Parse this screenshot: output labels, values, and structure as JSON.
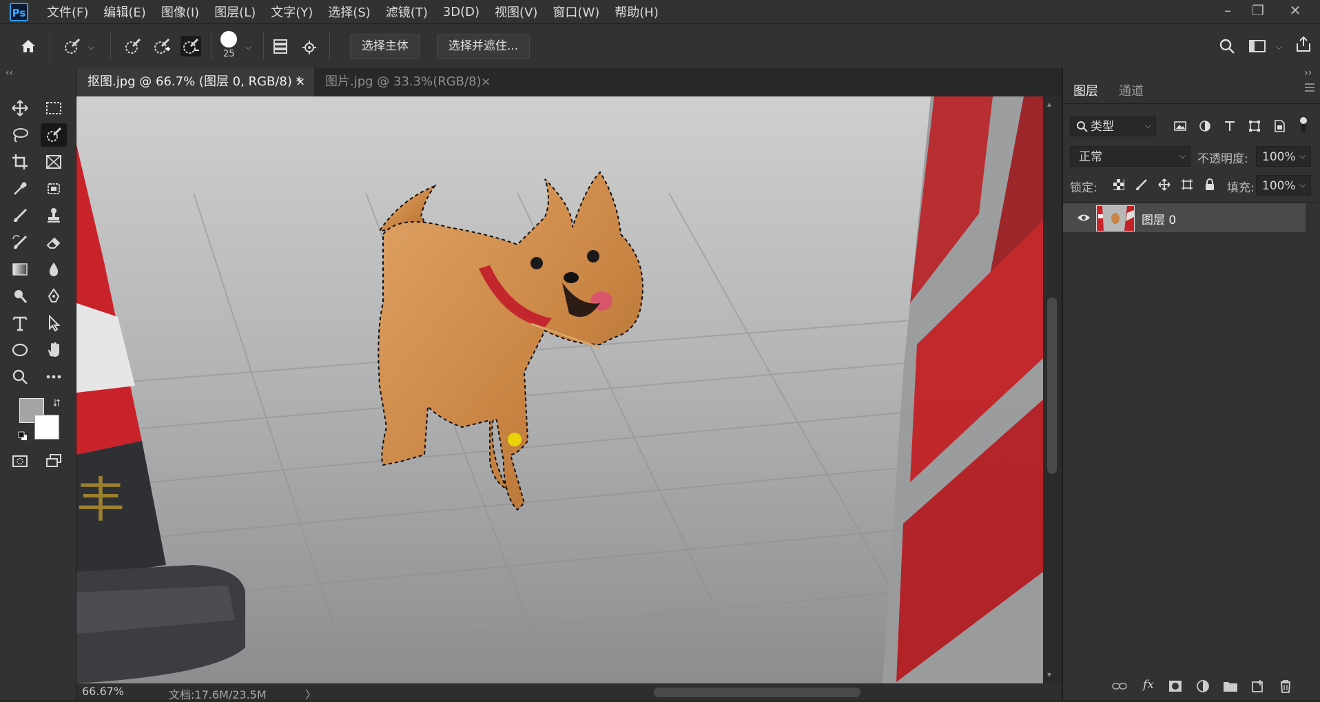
{
  "app": {
    "logo": "Ps"
  },
  "menu": [
    "文件(F)",
    "编辑(E)",
    "图像(I)",
    "图层(L)",
    "文字(Y)",
    "选择(S)",
    "滤镜(T)",
    "3D(D)",
    "视图(V)",
    "窗口(W)",
    "帮助(H)"
  ],
  "window_controls": {
    "minimize": "–",
    "restore": "❐",
    "close": "✕"
  },
  "options": {
    "brush_size": "25",
    "select_subject": "选择主体",
    "select_and_mask": "选择并遮住..."
  },
  "tabs": [
    {
      "label": "抠图.jpg @ 66.7% (图层 0, RGB/8) *",
      "close": "×"
    },
    {
      "label": "图片.jpg @ 33.3%(RGB/8)",
      "close": "×"
    }
  ],
  "status": {
    "zoom": "66.67%",
    "doc": "文档:17.6M/23.5M",
    "arrow": "〉"
  },
  "panel": {
    "tabs": [
      "图层",
      "通道"
    ],
    "filter_kind": "类型",
    "blend_mode": "正常",
    "opacity_label": "不透明度:",
    "opacity_value": "100%",
    "lock_label": "锁定:",
    "fill_label": "填充:",
    "fill_value": "100%",
    "layers": [
      {
        "name": "图层 0",
        "visible": true
      }
    ]
  },
  "colors": {
    "accent": "#31a8ff",
    "foreground": "#a5a5a5",
    "background": "#ffffff",
    "cone_red": "#c8232b"
  },
  "icons": {
    "toolbar": [
      "move-icon",
      "marquee-icon",
      "lasso-icon",
      "quick-select-icon",
      "crop-icon",
      "frame-icon",
      "eyedropper-icon",
      "patch-icon",
      "brush-icon",
      "stamp-icon",
      "history-brush-icon",
      "eraser-icon",
      "gradient-icon",
      "blur-icon",
      "dodge-icon",
      "pen-icon",
      "type-icon",
      "path-select-icon",
      "ellipse-icon",
      "hand-icon",
      "zoom-icon",
      "more-icon"
    ]
  }
}
